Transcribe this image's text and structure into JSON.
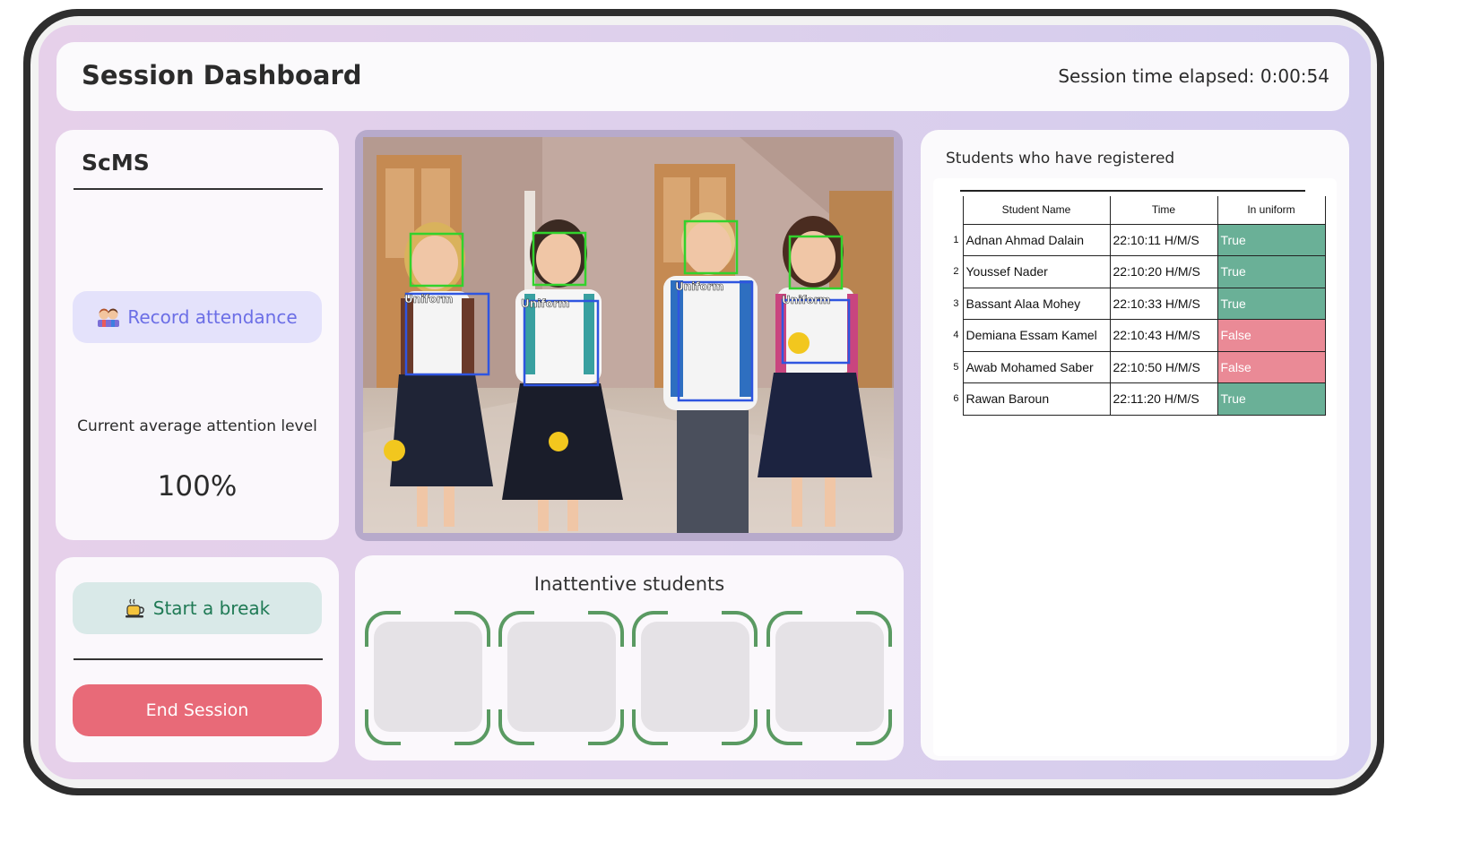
{
  "header": {
    "title": "Session Dashboard",
    "elapsed": "Session time elapsed: 0:00:54"
  },
  "sidebar": {
    "brand": "ScMS",
    "record_button": {
      "label": "Record attendance",
      "icon": "students-icon"
    },
    "attention_label": "Current average attention level",
    "attention_value": "100%",
    "break_button": {
      "label": "Start a break",
      "icon": "coffee-icon"
    },
    "end_button": {
      "label": "End Session"
    }
  },
  "camera": {
    "detection_label": "Uniform",
    "face_box_color": "#32d22c",
    "uniform_box_color": "#2f55e0",
    "people_count": 4
  },
  "inattentive": {
    "title": "Inattentive students",
    "slots": 4
  },
  "registered": {
    "title": "Students who have registered",
    "columns": [
      "Student Name",
      "Time",
      "In uniform"
    ],
    "rows": [
      {
        "idx": "1",
        "name": "Adnan Ahmad Dalain",
        "time": "22:10:11 H/M/S",
        "uniform": "True"
      },
      {
        "idx": "2",
        "name": "Youssef Nader",
        "time": "22:10:20 H/M/S",
        "uniform": "True"
      },
      {
        "idx": "3",
        "name": "Bassant Alaa Mohey",
        "time": "22:10:33 H/M/S",
        "uniform": "True"
      },
      {
        "idx": "4",
        "name": "Demiana Essam Kamel",
        "time": "22:10:43 H/M/S",
        "uniform": "False"
      },
      {
        "idx": "5",
        "name": "Awab Mohamed Saber",
        "time": "22:10:50 H/M/S",
        "uniform": "False"
      },
      {
        "idx": "6",
        "name": "Rawan Baroun",
        "time": "22:11:20 H/M/S",
        "uniform": "True"
      }
    ]
  },
  "colors": {
    "true_bg": "#6ab097",
    "false_bg": "#ea8a96",
    "record_text": "#6b6ee6",
    "break_text": "#1f7a55",
    "end_bg": "#e86a78"
  }
}
